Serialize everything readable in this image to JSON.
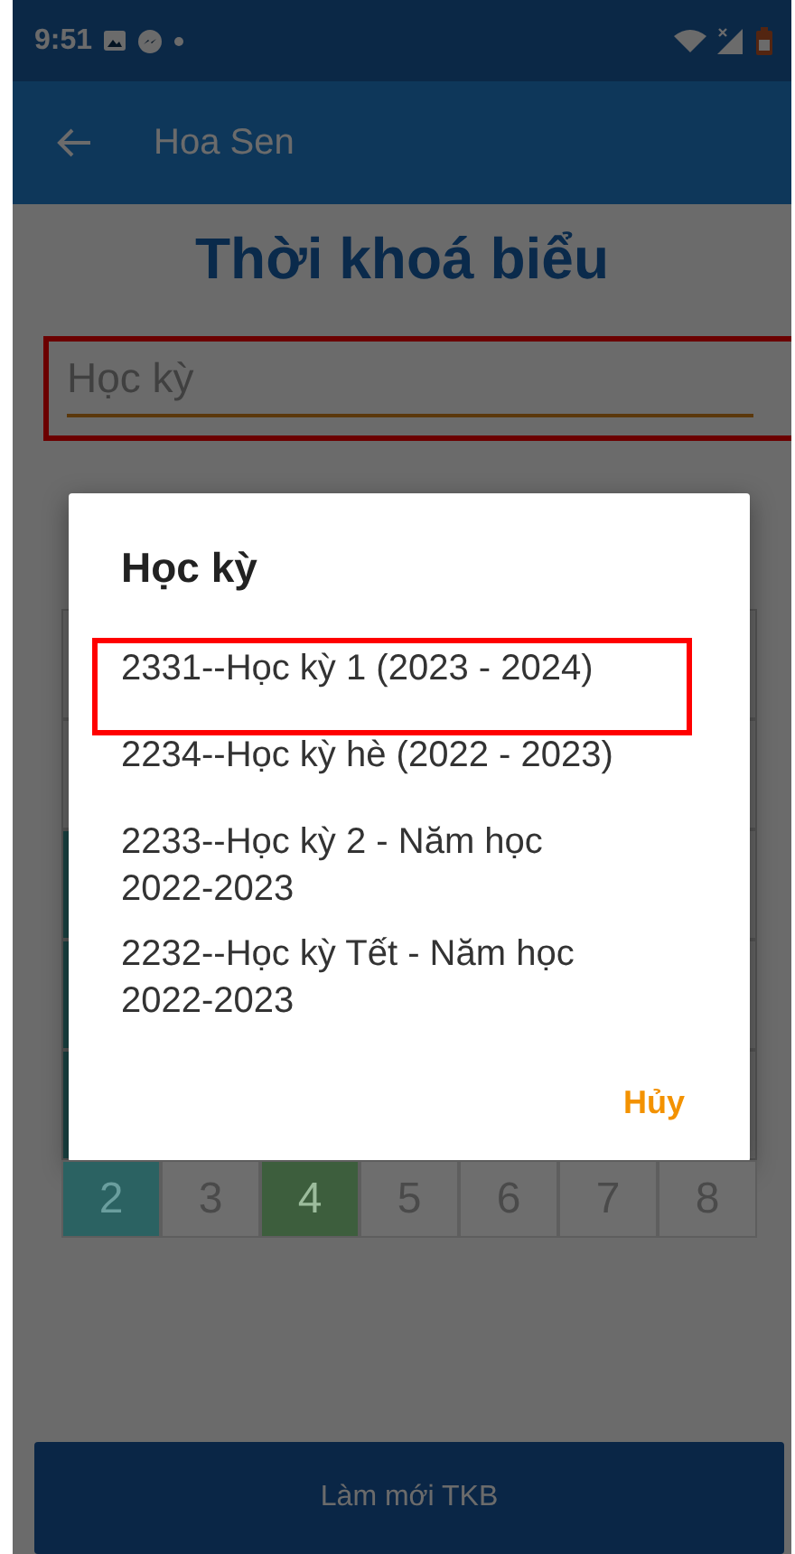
{
  "status_bar": {
    "time": "9:51"
  },
  "app_bar": {
    "title": "Hoa Sen"
  },
  "heading": "Thời khoá biểu",
  "semester_field": {
    "placeholder": "Học kỳ",
    "highlighted": true
  },
  "periods": [
    {
      "label": "2",
      "color": "#2b6262"
    },
    {
      "label": "3",
      "color": "#6e6e6e"
    },
    {
      "label": "4",
      "color": "#3d5e3d"
    },
    {
      "label": "5",
      "color": "#6e6e6e"
    },
    {
      "label": "6",
      "color": "#6e6e6e"
    },
    {
      "label": "7",
      "color": "#6e6e6e"
    },
    {
      "label": "8",
      "color": "#6e6e6e"
    }
  ],
  "dialog": {
    "title": "Học kỳ",
    "options": [
      {
        "label": "2331--Học kỳ 1 (2023 - 2024)",
        "highlighted": true
      },
      {
        "label": "2234--Học kỳ hè (2022 - 2023)",
        "highlighted": false
      },
      {
        "label": "2233--Học kỳ 2 - Năm học 2022-2023",
        "highlighted": false
      },
      {
        "label": "2232--Học kỳ Tết - Năm học 2022-2023",
        "highlighted": false
      }
    ],
    "cancel": "Hủy"
  },
  "refresh_button": "Làm mới TKB"
}
